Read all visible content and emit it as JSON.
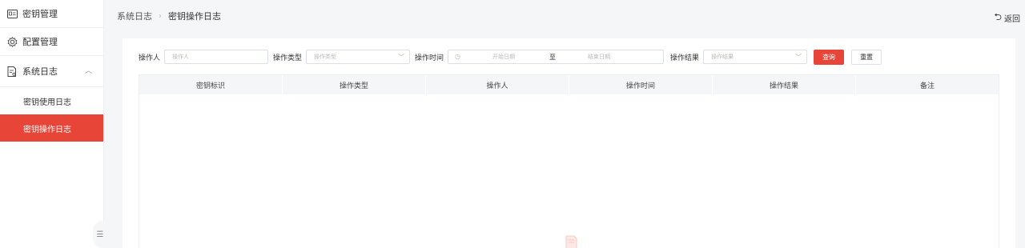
{
  "sidebar": {
    "items": [
      {
        "label": "密钥管理",
        "icon": "id-card-icon"
      },
      {
        "label": "配置管理",
        "icon": "settings-icon"
      },
      {
        "label": "系统日志",
        "icon": "log-file-icon"
      }
    ],
    "submenu": [
      {
        "label": "密钥使用日志"
      },
      {
        "label": "密钥操作日志",
        "active": true
      }
    ],
    "collapse_icon": "collapse-icon"
  },
  "breadcrumb": {
    "parent": "系统日志",
    "current": "密钥操作日志"
  },
  "back_label": "返回",
  "filters": {
    "operator_label": "操作人",
    "operator_placeholder": "操作人",
    "op_type_label": "操作类型",
    "op_type_placeholder": "操作类型",
    "op_time_label": "操作时间",
    "start_placeholder": "开始日期",
    "range_sep": "至",
    "end_placeholder": "结束日期",
    "result_label": "操作结果",
    "result_placeholder": "操作结果",
    "query_label": "查询",
    "reset_label": "重置"
  },
  "table": {
    "headers": [
      "密钥标识",
      "操作类型",
      "操作人",
      "操作时间",
      "操作结果",
      "备注"
    ],
    "rows": []
  },
  "colors": {
    "accent": "#e84539"
  }
}
